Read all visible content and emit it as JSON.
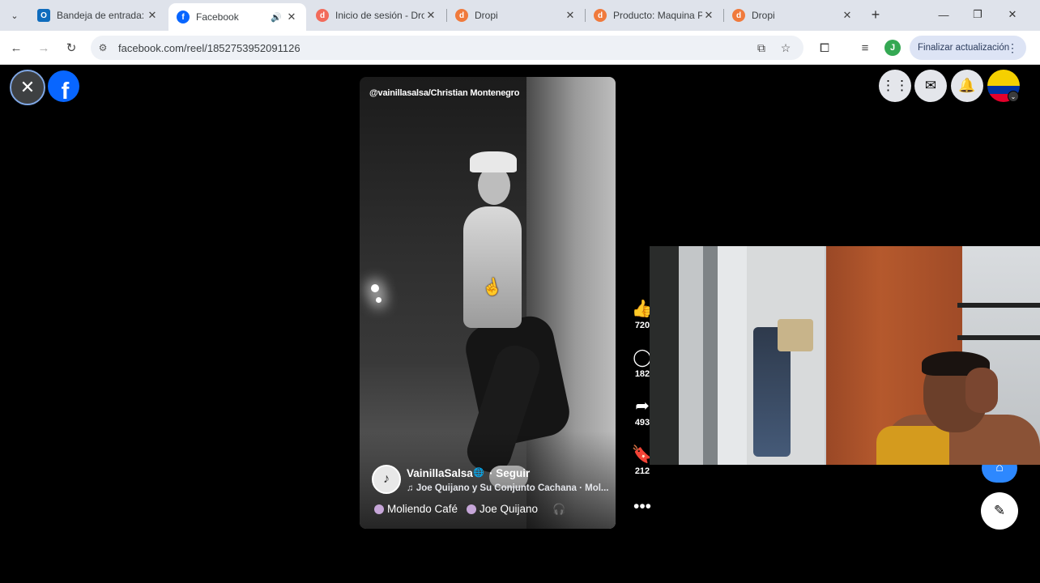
{
  "browser": {
    "tabs": [
      {
        "title": "Bandeja de entrada: j",
        "favicon": "outlook-icon",
        "active": false
      },
      {
        "title": "Facebook",
        "favicon": "facebook-icon",
        "active": true,
        "audio": true
      },
      {
        "title": "Inicio de sesión - Dro",
        "favicon": "dropi-icon",
        "active": false
      },
      {
        "title": "Dropi",
        "favicon": "dropi-icon",
        "active": false
      },
      {
        "title": "Producto: Maquina P",
        "favicon": "dropi-icon",
        "active": false
      },
      {
        "title": "Dropi",
        "favicon": "dropi-icon",
        "active": false
      }
    ],
    "url": "facebook.com/reel/1852753952091126",
    "profile_initial": "J",
    "update_label": "Finalizar actualización"
  },
  "reel": {
    "watermark": "@vainillasalsa/Christian Montenegro",
    "author": "VainillaSalsa",
    "follow_label": "· Seguir",
    "music": "♫ Joe Quijano y Su Conjunto Cachana · Mol...",
    "tag1": "Moliendo Café",
    "tag2": "Joe Quijano",
    "actions": {
      "likes": "720",
      "comments": "182",
      "shares": "493",
      "saves": "212"
    }
  },
  "colors": {
    "fb_blue": "#0866ff",
    "tab_strip": "#dfe3eb"
  }
}
